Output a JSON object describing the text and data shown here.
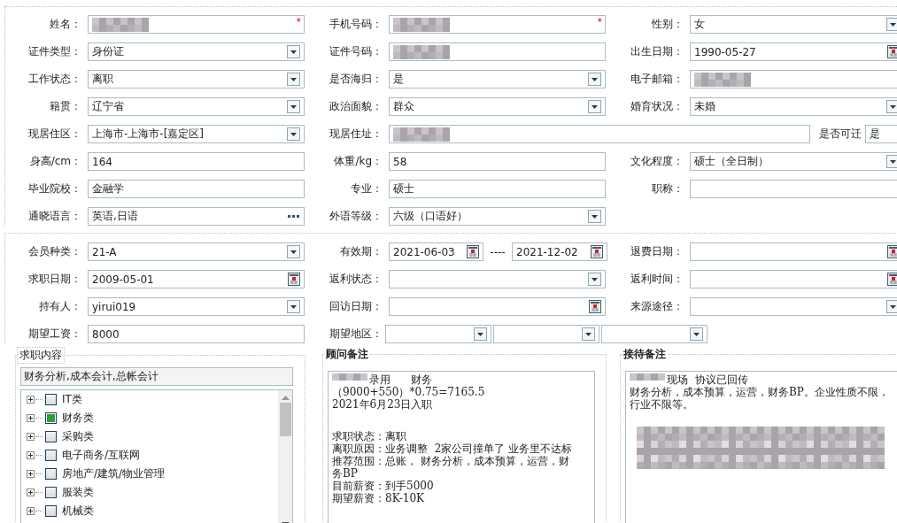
{
  "personal": {
    "rows": [
      [
        {
          "label": "姓名：",
          "kind": "text",
          "redacted": true,
          "required_mark": "*"
        },
        {
          "label": "手机号码：",
          "kind": "text",
          "redacted": true,
          "required_mark": "*"
        },
        {
          "label": "性别：",
          "kind": "select",
          "value": "女"
        }
      ],
      [
        {
          "label": "证件类型：",
          "kind": "select",
          "value": "身份证"
        },
        {
          "label": "证件号码：",
          "kind": "text",
          "redacted": true
        },
        {
          "label": "出生日期：",
          "kind": "date",
          "value": "1990-05-27"
        }
      ],
      [
        {
          "label": "工作状态：",
          "kind": "select",
          "value": "离职"
        },
        {
          "label": "是否海归：",
          "kind": "select",
          "value": "是"
        },
        {
          "label": "电子邮箱：",
          "kind": "text",
          "redacted": true
        }
      ],
      [
        {
          "label": "籍贯：",
          "kind": "select",
          "value": "辽宁省"
        },
        {
          "label": "政治面貌：",
          "kind": "select",
          "value": "群众"
        },
        {
          "label": "婚育状况：",
          "kind": "select",
          "value": "未婚"
        }
      ],
      [
        {
          "label": "现居住区：",
          "kind": "select",
          "value": "上海市-上海市-[嘉定区]"
        },
        {
          "label": "现居住址：",
          "kind": "text",
          "redacted": true
        },
        {
          "label": "是否可迁",
          "kind": "short-select",
          "value": "是"
        }
      ],
      [
        {
          "label": "身高/cm：",
          "kind": "text",
          "value": "164"
        },
        {
          "label": "体重/kg：",
          "kind": "text",
          "value": "58"
        },
        {
          "label": "文化程度：",
          "kind": "select",
          "value": "硕士（全日制）"
        }
      ],
      [
        {
          "label": "毕业院校：",
          "kind": "text",
          "value": "金融学"
        },
        {
          "label": "专业：",
          "kind": "text",
          "value": "硕士"
        },
        {
          "label": "职称：",
          "kind": "text"
        }
      ],
      [
        {
          "label": "通晓语言：",
          "kind": "lookup",
          "value": "英语,日语"
        },
        {
          "label": "外语等级：",
          "kind": "select",
          "value": "六级（口语好）"
        }
      ]
    ]
  },
  "membership": {
    "rows": [
      [
        {
          "label": "会员种类：",
          "kind": "select",
          "value": "21-A"
        },
        {
          "label": "有效期：",
          "kind": "date-range",
          "from": "2021-06-03",
          "separator": "----",
          "to": "2021-12-02"
        },
        {
          "label": "退费日期：",
          "kind": "date"
        }
      ],
      [
        {
          "label": "求职日期：",
          "kind": "date",
          "value": "2009-05-01"
        },
        {
          "label": "返利状态：",
          "kind": "select"
        },
        {
          "label": "返利时间：",
          "kind": "date"
        }
      ],
      [
        {
          "label": "持有人：",
          "kind": "select",
          "value": "yirui019"
        },
        {
          "label": "回访日期：",
          "kind": "date"
        },
        {
          "label": "来源途径：",
          "kind": "select"
        }
      ],
      [
        {
          "label": "期望工资：",
          "kind": "text",
          "value": "8000"
        },
        {
          "label": "期望地区：",
          "kind": "region"
        }
      ]
    ]
  },
  "job_intent": {
    "title": "求职内容",
    "summary": "财务分析,成本会计,总帐会计",
    "categories": [
      {
        "label": "IT类",
        "checked": false,
        "expanded": false
      },
      {
        "label": "财务类",
        "checked": true,
        "expanded": false
      },
      {
        "label": "采购类",
        "checked": false,
        "expanded": false
      },
      {
        "label": "电子商务/互联网",
        "checked": false,
        "expanded": false
      },
      {
        "label": "房地产/建筑/物业管理",
        "checked": false,
        "expanded": false
      },
      {
        "label": "服装类",
        "checked": false,
        "expanded": false
      },
      {
        "label": "机械类",
        "checked": false,
        "expanded": false
      }
    ]
  },
  "advisor_note": {
    "title": "顾问备注",
    "paragraphs": [
      {
        "lines": [
          {
            "redacted": true,
            "text": "录用      财务"
          },
          {
            "redacted": false,
            "text": "（9000+550）*0.75=7165.5"
          },
          {
            "redacted": false,
            "text": "2021年6月23日入职"
          }
        ]
      },
      {
        "lines": [
          {
            "redacted": false,
            "text": "求职状态：离职"
          },
          {
            "redacted": false,
            "text": "离职原因：业务调整  2家公司撞单了 业务里不达标"
          },
          {
            "redacted": false,
            "text": "推荐范围：总账， 财务分析，成本预算，运营，财务BP"
          },
          {
            "redacted": false,
            "text": "目前薪资：到手5000"
          },
          {
            "redacted": false,
            "text": "期望薪资：8K-10K"
          }
        ]
      }
    ]
  },
  "reception_note": {
    "title": "接待备注",
    "paragraphs": [
      {
        "lines": [
          {
            "redacted": true,
            "text": "现场  协议已回传"
          },
          {
            "redacted": false,
            "text": "财务分析，成本预算，运营，财务BP。企业性质不限，行业不限等。"
          }
        ]
      },
      {
        "lines": [
          {
            "redacted": true
          }
        ]
      }
    ]
  }
}
